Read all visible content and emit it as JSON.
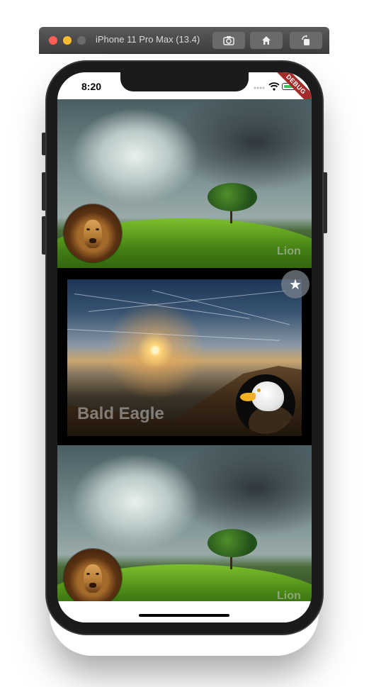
{
  "simulator": {
    "title": "iPhone 11 Pro Max (13.4)",
    "buttons": [
      "screenshot-icon",
      "home-icon",
      "rotate-icon"
    ]
  },
  "status_bar": {
    "time": "8:20",
    "debug_banner": "DEBUG"
  },
  "cards": [
    {
      "label": "Lion",
      "avatar": "lion"
    },
    {
      "label": "Bald Eagle",
      "avatar": "eagle",
      "favorite_icon": "★"
    },
    {
      "label": "Lion",
      "avatar": "lion"
    }
  ],
  "colors": {
    "debug_ribbon": "#a52a2a",
    "battery": "#34c759",
    "fav_button": "#78828c"
  }
}
